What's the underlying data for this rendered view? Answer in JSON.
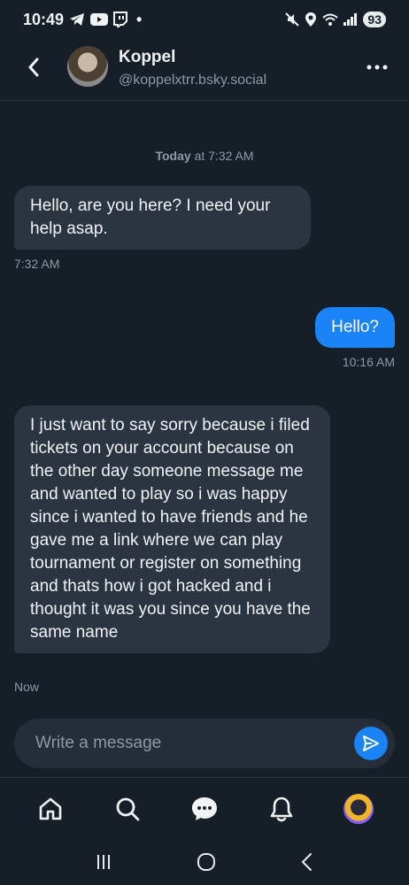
{
  "status_bar": {
    "time": "10:49",
    "dot": "•",
    "battery": "93"
  },
  "header": {
    "name": "Koppel",
    "handle": "@koppelxtrr.bsky.social"
  },
  "date_separator": {
    "day": "Today",
    "rest": " at 7:32 AM"
  },
  "messages": [
    {
      "direction": "in",
      "text": "Hello, are you here? I need your help asap.",
      "time": "7:32 AM"
    },
    {
      "direction": "out",
      "text": "Hello?",
      "time": "10:16 AM"
    },
    {
      "direction": "in",
      "text": "I just want to say sorry because i filed tickets on your account because on the other day someone message me and wanted to play so i was happy since i wanted to have friends and he gave me a link where we can play tournament or register on something and thats how i got hacked and i thought it was you since you have the same name",
      "time": "Now"
    }
  ],
  "composer": {
    "placeholder": "Write a message"
  },
  "tabs": [
    "home-icon",
    "search-icon",
    "chat-icon",
    "bell-icon",
    "profile-avatar"
  ],
  "nav": [
    "recents-icon",
    "home-nav-icon",
    "back-nav-icon"
  ],
  "colors": {
    "background": "#161e27",
    "incoming_bubble": "#2b3541",
    "outgoing_bubble": "#1a83f5",
    "muted_text": "#8d99a6"
  }
}
